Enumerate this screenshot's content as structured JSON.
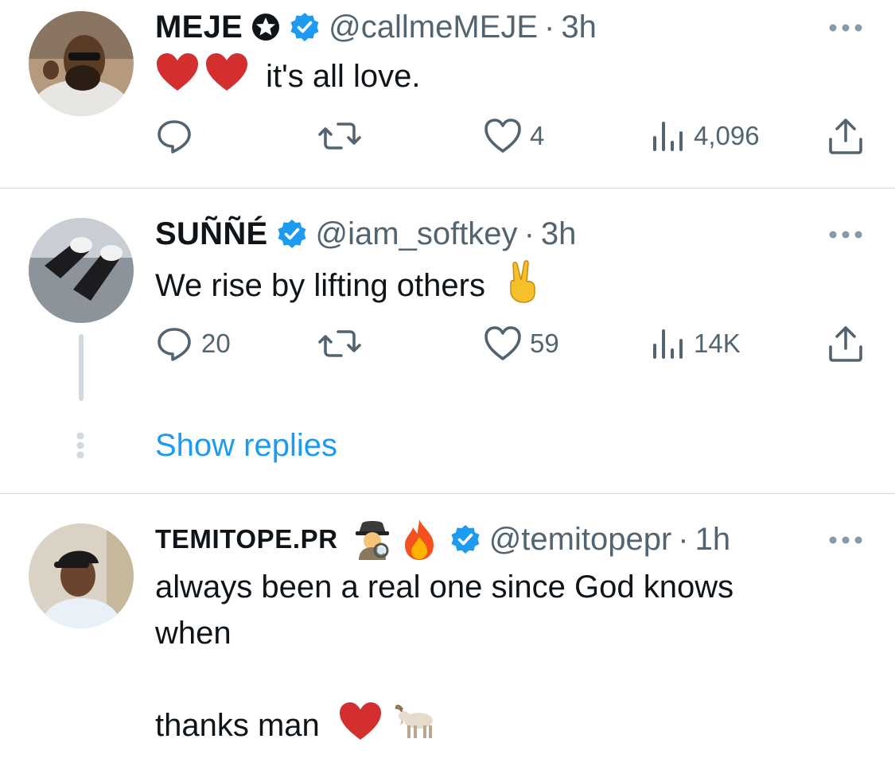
{
  "tweets": [
    {
      "display_name": "MEJE",
      "handle": "@callmeMEJE",
      "separator": "·",
      "time": "3h",
      "text": "it's all love.",
      "text_emoji_prefix": [
        "red-heart",
        "red-heart"
      ],
      "replies": "",
      "likes": "4",
      "views": "4,096"
    },
    {
      "display_name": "SUÑÑÉ",
      "handle": "@iam_softkey",
      "separator": "·",
      "time": "3h",
      "text": "We rise by lifting others",
      "text_emoji_suffix": [
        "victory-hand"
      ],
      "replies": "20",
      "likes": "59",
      "views": "14K"
    },
    {
      "display_name": "TEMITOPE.PR",
      "name_emojis": [
        "detective",
        "fire"
      ],
      "handle": "@temitopepr",
      "separator": "·",
      "time": "1h",
      "text_line1": "always been a real one since God knows",
      "text_line2": "when",
      "text_line3": "thanks man",
      "text_emoji_suffix": [
        "red-heart",
        "goat"
      ]
    }
  ],
  "thread": {
    "show_replies_label": "Show replies"
  },
  "colors": {
    "accent": "#1d9bf0",
    "secondary_text": "#536471",
    "divider": "#cfd9de",
    "heart": "#e0245e"
  }
}
